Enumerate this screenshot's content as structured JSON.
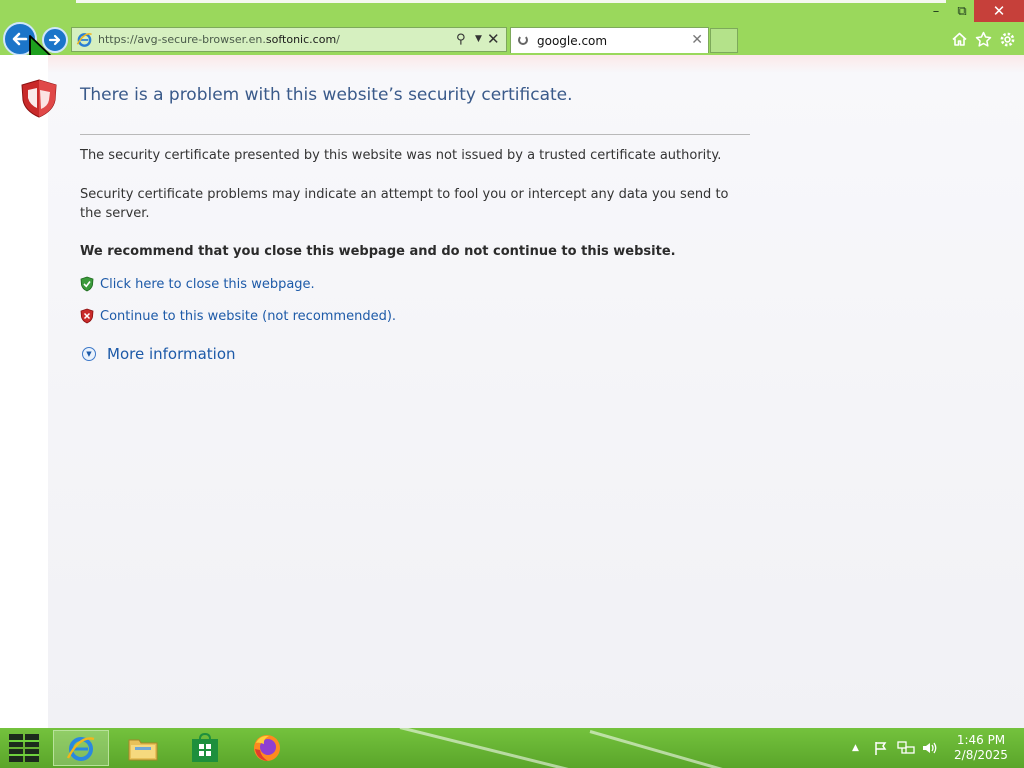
{
  "window": {
    "minimize": "–",
    "restore": "⧉",
    "close": "✕"
  },
  "nav": {
    "back_icon": "arrow-left",
    "forward_icon": "arrow-right"
  },
  "address_bar": {
    "url_prefix": "https://avg-secure-browser.en.",
    "url_domain": "softonic.com",
    "url_suffix": "/"
  },
  "tab": {
    "label": "google.com"
  },
  "page": {
    "title": "There is a problem with this website’s security certificate.",
    "para1": "The security certificate presented by this website was not issued by a trusted certificate authority.",
    "para2": "Security certificate problems may indicate an attempt to fool you or intercept any data you send to the server.",
    "recommend": "We recommend that you close this webpage and do not continue to this website.",
    "close_link": "Click here to close this webpage.",
    "continue_link": "Continue to this website (not recommended).",
    "more_info": "More information"
  },
  "taskbar": {
    "apps": [
      "Internet Explorer",
      "File Explorer",
      "Store",
      "Firefox"
    ],
    "time": "1:46 PM",
    "date": "2/8/2025"
  },
  "colors": {
    "chrome": "#9ad85c",
    "accent_blue": "#1b75c9",
    "link": "#1d5aa8",
    "title": "#3a5a8a",
    "close_red": "#c6403a",
    "shield_red": "#c92a2a",
    "shield_green": "#3b9a3b"
  }
}
